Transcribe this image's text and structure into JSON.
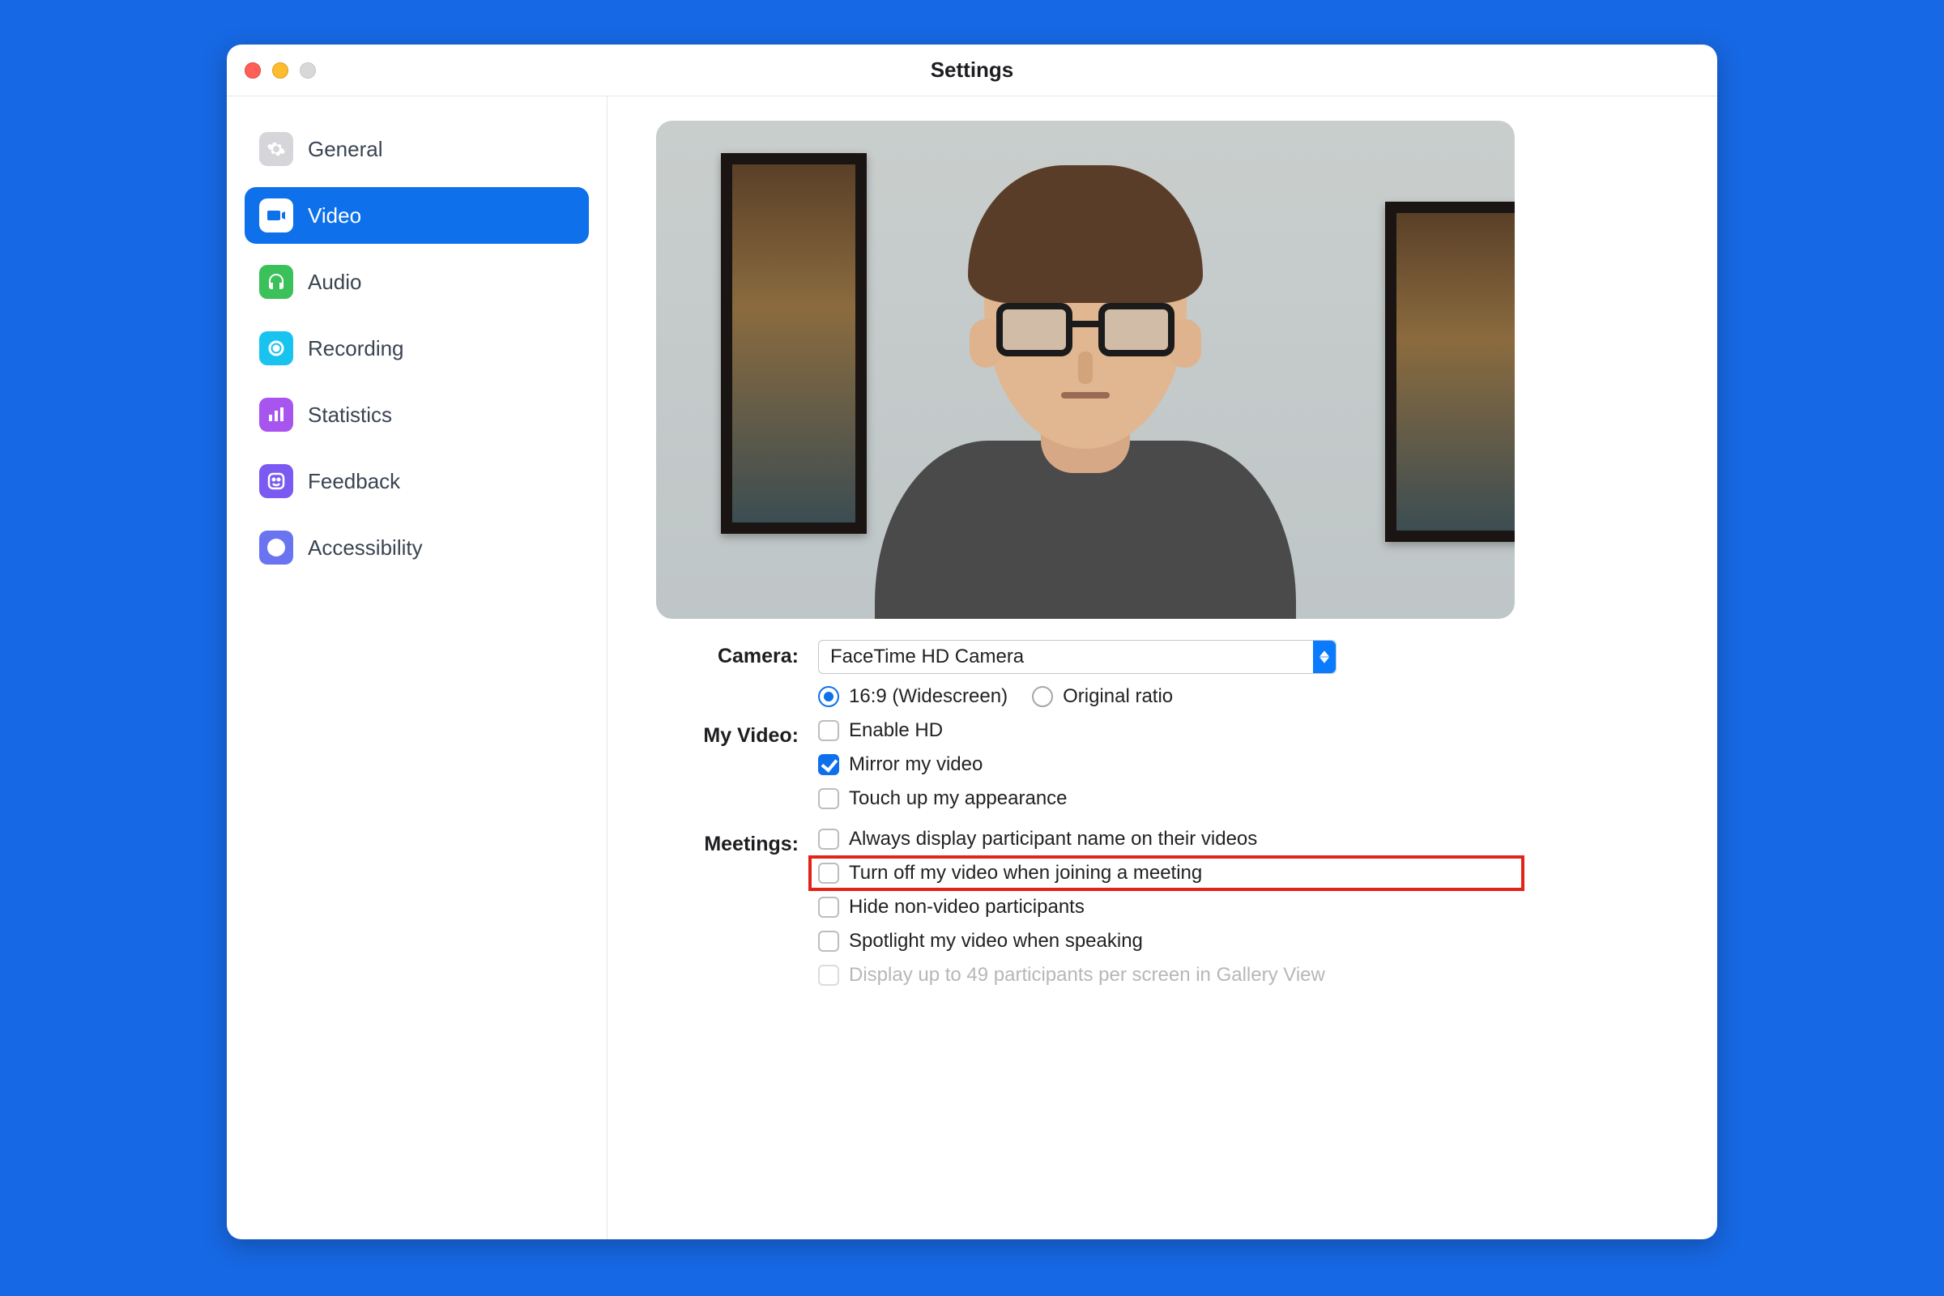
{
  "window": {
    "title": "Settings"
  },
  "sidebar": {
    "items": [
      {
        "key": "general",
        "label": "General",
        "icon": "gear",
        "bg": "#d6d6da",
        "fg": "#ffffff"
      },
      {
        "key": "video",
        "label": "Video",
        "icon": "video",
        "bg": "#0e71eb",
        "fg": "#ffffff",
        "active": true
      },
      {
        "key": "audio",
        "label": "Audio",
        "icon": "headphones",
        "bg": "#3bc15a",
        "fg": "#ffffff"
      },
      {
        "key": "recording",
        "label": "Recording",
        "icon": "record",
        "bg": "#19c3f0",
        "fg": "#ffffff"
      },
      {
        "key": "statistics",
        "label": "Statistics",
        "icon": "bars",
        "bg": "#a855f0",
        "fg": "#ffffff"
      },
      {
        "key": "feedback",
        "label": "Feedback",
        "icon": "smile",
        "bg": "#7a5af0",
        "fg": "#ffffff"
      },
      {
        "key": "accessibility",
        "label": "Accessibility",
        "icon": "person",
        "bg": "#6b74f0",
        "fg": "#ffffff"
      }
    ]
  },
  "camera": {
    "label": "Camera:",
    "selected": "FaceTime HD Camera",
    "ratio": {
      "widescreen": "16:9 (Widescreen)",
      "original": "Original ratio",
      "selected": "widescreen"
    }
  },
  "my_video": {
    "label": "My Video:",
    "enable_hd": {
      "label": "Enable HD",
      "checked": false
    },
    "mirror": {
      "label": "Mirror my video",
      "checked": true
    },
    "touch_up": {
      "label": "Touch up my appearance",
      "checked": false
    }
  },
  "meetings": {
    "label": "Meetings:",
    "always_name": {
      "label": "Always display participant name on their videos",
      "checked": false
    },
    "turn_off_join": {
      "label": "Turn off my video when joining a meeting",
      "checked": false,
      "highlighted": true
    },
    "hide_nonvideo": {
      "label": "Hide non-video participants",
      "checked": false
    },
    "spotlight": {
      "label": "Spotlight my video when speaking",
      "checked": false
    },
    "gallery49": {
      "label": "Display up to 49 participants per screen in Gallery View",
      "checked": false,
      "disabled": true
    }
  }
}
